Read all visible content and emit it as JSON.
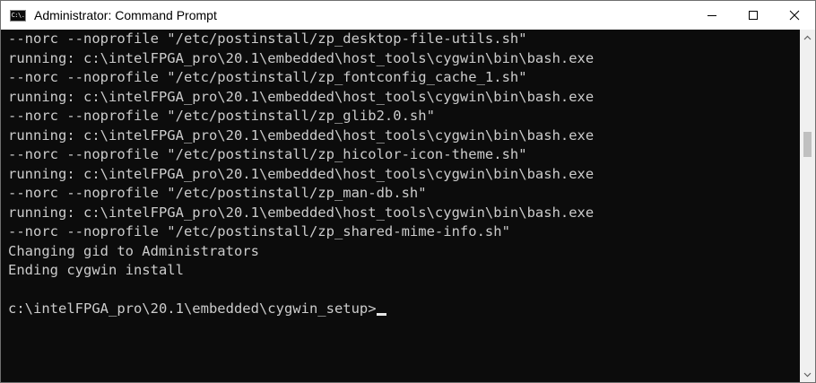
{
  "window": {
    "title": "Administrator: Command Prompt",
    "icon_text": "C:\\."
  },
  "controls": {
    "minimize": "minimize-icon",
    "maximize": "maximize-icon",
    "close": "close-icon"
  },
  "console": {
    "lines": [
      "--norc --noprofile \"/etc/postinstall/zp_desktop-file-utils.sh\"",
      "running: c:\\intelFPGA_pro\\20.1\\embedded\\host_tools\\cygwin\\bin\\bash.exe",
      "--norc --noprofile \"/etc/postinstall/zp_fontconfig_cache_1.sh\"",
      "running: c:\\intelFPGA_pro\\20.1\\embedded\\host_tools\\cygwin\\bin\\bash.exe",
      "--norc --noprofile \"/etc/postinstall/zp_glib2.0.sh\"",
      "running: c:\\intelFPGA_pro\\20.1\\embedded\\host_tools\\cygwin\\bin\\bash.exe",
      "--norc --noprofile \"/etc/postinstall/zp_hicolor-icon-theme.sh\"",
      "running: c:\\intelFPGA_pro\\20.1\\embedded\\host_tools\\cygwin\\bin\\bash.exe",
      "--norc --noprofile \"/etc/postinstall/zp_man-db.sh\"",
      "running: c:\\intelFPGA_pro\\20.1\\embedded\\host_tools\\cygwin\\bin\\bash.exe",
      "--norc --noprofile \"/etc/postinstall/zp_shared-mime-info.sh\"",
      "Changing gid to Administrators",
      "Ending cygwin install",
      "",
      "c:\\intelFPGA_pro\\20.1\\embedded\\cygwin_setup>"
    ]
  },
  "colors": {
    "console_bg": "#0c0c0c",
    "console_fg": "#cccccc",
    "titlebar_bg": "#ffffff"
  }
}
